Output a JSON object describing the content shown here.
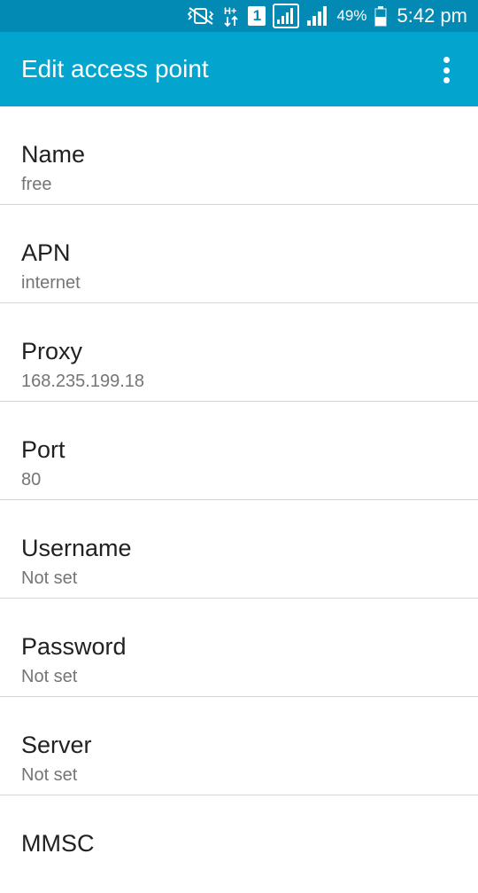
{
  "status_bar": {
    "network_type": "H+",
    "sim_slot": "1",
    "battery_percent": "49%",
    "time": "5:42 pm",
    "icons": [
      "mute-vibrate-icon",
      "data-arrows-icon",
      "sim-badge-icon",
      "signal-sim1-icon",
      "signal-sim2-icon",
      "battery-icon"
    ]
  },
  "action_bar": {
    "title": "Edit access point",
    "overflow_icon": "more-vert-icon"
  },
  "colors": {
    "status_bar_bg": "#0289b4",
    "action_bar_bg": "#03a4cd",
    "label_text": "#212121",
    "value_text": "#757575",
    "divider": "#d6d6d6"
  },
  "preferences": [
    {
      "label": "Name",
      "value": "free"
    },
    {
      "label": "APN",
      "value": "internet"
    },
    {
      "label": "Proxy",
      "value": "168.235.199.18"
    },
    {
      "label": "Port",
      "value": "80"
    },
    {
      "label": "Username",
      "value": "Not set"
    },
    {
      "label": "Password",
      "value": "Not set"
    },
    {
      "label": "Server",
      "value": "Not set"
    },
    {
      "label": "MMSC",
      "value": ""
    }
  ]
}
